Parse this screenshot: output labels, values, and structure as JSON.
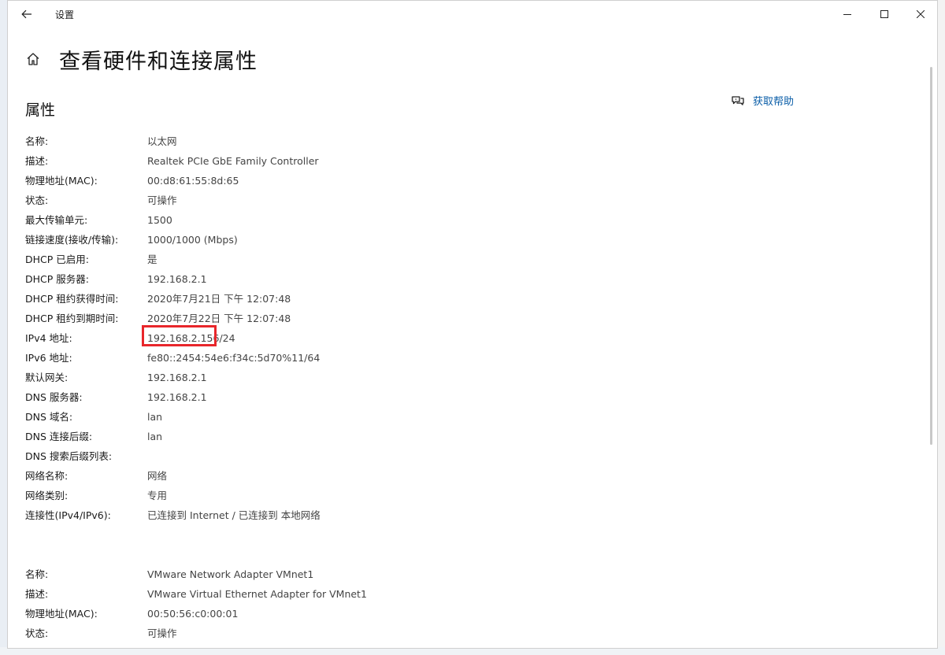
{
  "window": {
    "app_title": "设置",
    "page_title": "查看硬件和连接属性",
    "section_title": "属性",
    "help_label": "获取帮助"
  },
  "adapters": [
    {
      "rows": [
        {
          "label": "名称:",
          "value": "以太网"
        },
        {
          "label": "描述:",
          "value": "Realtek PCIe GbE Family Controller"
        },
        {
          "label": "物理地址(MAC):",
          "value": "00:d8:61:55:8d:65"
        },
        {
          "label": "状态:",
          "value": "可操作"
        },
        {
          "label": "最大传输单元:",
          "value": "1500"
        },
        {
          "label": "链接速度(接收/传输):",
          "value": "1000/1000 (Mbps)"
        },
        {
          "label": "DHCP 已启用:",
          "value": "是"
        },
        {
          "label": "DHCP 服务器:",
          "value": "192.168.2.1"
        },
        {
          "label": "DHCP 租约获得时间:",
          "value": "2020年7月21日 下午 12:07:48"
        },
        {
          "label": "DHCP 租约到期时间:",
          "value": "2020年7月22日 下午 12:07:48"
        },
        {
          "label": "IPv4 地址:",
          "value": "192.168.2.156/24"
        },
        {
          "label": "IPv6 地址:",
          "value": "fe80::2454:54e6:f34c:5d70%11/64"
        },
        {
          "label": "默认网关:",
          "value": "192.168.2.1"
        },
        {
          "label": "DNS 服务器:",
          "value": "192.168.2.1"
        },
        {
          "label": "DNS 域名:",
          "value": "lan"
        },
        {
          "label": "DNS 连接后缀:",
          "value": "lan"
        },
        {
          "label": "DNS 搜索后缀列表:",
          "value": ""
        },
        {
          "label": "网络名称:",
          "value": "网络"
        },
        {
          "label": "网络类别:",
          "value": "专用"
        },
        {
          "label": "连接性(IPv4/IPv6):",
          "value": "已连接到 Internet / 已连接到 本地网络"
        }
      ]
    },
    {
      "rows": [
        {
          "label": "名称:",
          "value": "VMware Network Adapter VMnet1"
        },
        {
          "label": "描述:",
          "value": "VMware Virtual Ethernet Adapter for VMnet1"
        },
        {
          "label": "物理地址(MAC):",
          "value": "00:50:56:c0:00:01"
        },
        {
          "label": "状态:",
          "value": "可操作"
        }
      ]
    }
  ],
  "colors": {
    "link": "#0b5ea8",
    "highlight_border": "#e8262b"
  },
  "icons": [
    "back-arrow-icon",
    "home-icon",
    "minimize-icon",
    "maximize-icon",
    "close-icon",
    "help-chat-icon"
  ]
}
